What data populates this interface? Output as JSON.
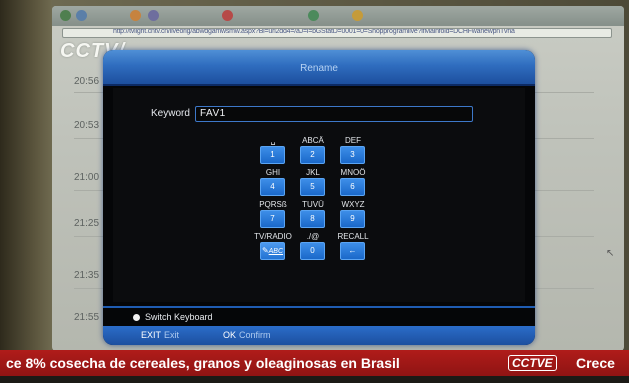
{
  "browser": {
    "address": "http://tvlight.cntv.cn/liveorig/abwdgamwsmw.aspx?Bl=url2dd4=/aJ=l=bGStatD=0001=0=Shopprogramlive?ifMainfold=DCHFwanewpnTvna",
    "site_logo": "CCTV/"
  },
  "background_times": [
    "20:56",
    "20:53",
    "21:00",
    "21:25",
    "21:35",
    "21:55"
  ],
  "dialog": {
    "title": "Rename",
    "keyword_label": "Keyword",
    "keyword_value": "FAV1",
    "keys": [
      {
        "caption": "␣",
        "label": "1"
      },
      {
        "caption": "ABCÄ",
        "label": "2"
      },
      {
        "caption": "DEF",
        "label": "3"
      },
      {
        "caption": "GHI",
        "label": "4"
      },
      {
        "caption": "JKL",
        "label": "5"
      },
      {
        "caption": "MNOÖ",
        "label": "6"
      },
      {
        "caption": "PQRSß",
        "label": "7"
      },
      {
        "caption": "TUVÜ",
        "label": "8"
      },
      {
        "caption": "WXYZ",
        "label": "9"
      },
      {
        "caption": "TV/RADIO",
        "label": "ABC"
      },
      {
        "caption": "./@",
        "label": "0"
      },
      {
        "caption": "RECALL",
        "label": "←"
      }
    ],
    "switch_keyboard_label": "Switch Keyboard",
    "help": {
      "exit_key": "EXIT",
      "exit_label": "Exit",
      "ok_key": "OK",
      "ok_label": "Confirm"
    }
  },
  "ticker": {
    "text": "ce 8% cosecha de cereales, granos y oleaginosas en Brasil",
    "logo": "CCTVE",
    "more": "Crece"
  },
  "colors": {
    "dialog_accent": "#2f6dbf",
    "key_button": "#1a68c9",
    "ticker_bg": "#b01c1a"
  }
}
